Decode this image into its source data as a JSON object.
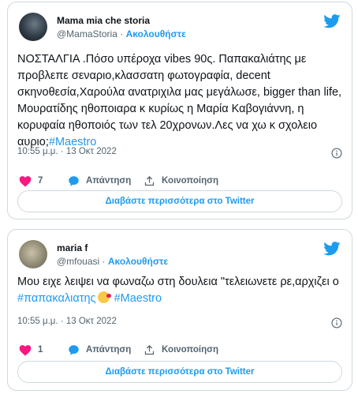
{
  "tweets": [
    {
      "author_name": "Mama mia che storia",
      "handle": "@MamaStoria",
      "separator": "·",
      "follow_label": "Ακολουθήστε",
      "text_part1": "ΝΟΣΤΑΛΓΙΑ .Πόσο υπέροχα vibes 90ς. Παπακαλιάτης με προβλεπε σεναριο,κλασσατη φωτογραφία, decent σκηνοθεσία,Χαρούλα ανατριχιλα μας μεγάλωσε, bigger than life, Μουρατίδης ηθοποιαρα κ κυρίως η Μαρία Καβογιάννη, η κορυφαία ηθοποιός των τελ 20χρονων.Λες να χω κ σχολειο αυριο;",
      "hashtag1": "#Maestro",
      "timestamp": "10:55 μ.μ. · 13 Οκτ 2022",
      "like_count": "7",
      "reply_label": "Απάντηση",
      "share_label": "Κοινοποίηση",
      "read_more_label": "Διαβάστε περισσότερα στο Twitter"
    },
    {
      "author_name": "maria f",
      "handle": "@mfouasi",
      "separator": "·",
      "follow_label": "Ακολουθήστε",
      "text_part1": "Μου ειχε λειψει να φωναζω στη δουλεια \"τελειωνετε ρε,αρχιζει ο ",
      "hashtag1": "#παπακαλιατης",
      "hashtag2": "#Maestro",
      "emoji": "face-blowing-kiss",
      "timestamp": "10:55 μ.μ. · 13 Οκτ 2022",
      "like_count": "1",
      "reply_label": "Απάντηση",
      "share_label": "Κοινοποίηση",
      "read_more_label": "Διαβάστε περισσότερα στο Twitter"
    }
  ],
  "colors": {
    "accent": "#1d9bf0",
    "like": "#f91880",
    "muted": "#536471",
    "border": "#cfd9de"
  },
  "icons": {
    "logo": "twitter-bird-icon",
    "like": "heart-icon",
    "reply": "comment-bubble-icon",
    "share": "share-upload-icon",
    "info": "info-circle-icon"
  }
}
